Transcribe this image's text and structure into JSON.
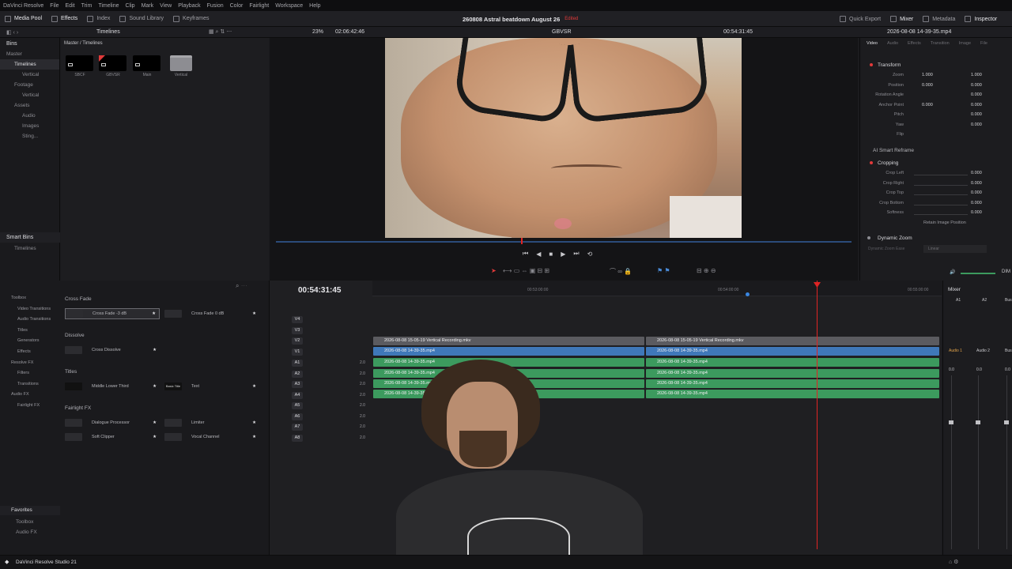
{
  "menubar": {
    "items": [
      "DaVinci Resolve",
      "File",
      "Edit",
      "Trim",
      "Timeline",
      "Clip",
      "Mark",
      "View",
      "Playback",
      "Fusion",
      "Color",
      "Fairlight",
      "Workspace",
      "Help"
    ]
  },
  "toolbar": {
    "media_pool": "Media Pool",
    "effects": "Effects",
    "index": "Index",
    "sound_library": "Sound Library",
    "keyframes": "Keyframes",
    "project_title": "260808 Astral beatdown August 26",
    "edited": "Edited",
    "quick_export": "Quick Export",
    "mixer": "Mixer",
    "metadata": "Metadata",
    "inspector": "Inspector"
  },
  "subbar": {
    "timelines": "Timelines",
    "zoom": "23%",
    "source_tc": "02:06:42:46",
    "viewer_title": "GBVSR",
    "record_tc": "00:54:31:45",
    "clip_name": "2026-08-08 14-39-35.mp4"
  },
  "bins": {
    "header": "Bins",
    "items": [
      {
        "label": "Master",
        "sel": false,
        "indent": 0
      },
      {
        "label": "Timelines",
        "sel": true,
        "indent": 1
      },
      {
        "label": "Vertical",
        "sel": false,
        "indent": 2
      },
      {
        "label": "Footage",
        "sel": false,
        "indent": 1
      },
      {
        "label": "Vertical",
        "sel": false,
        "indent": 2
      },
      {
        "label": "Assets",
        "sel": false,
        "indent": 1
      },
      {
        "label": "Audio",
        "sel": false,
        "indent": 2
      },
      {
        "label": "Images",
        "sel": false,
        "indent": 2
      },
      {
        "label": "Sting...",
        "sel": false,
        "indent": 2
      }
    ],
    "smart_bins": "Smart Bins",
    "smart_items": [
      "Timelines"
    ]
  },
  "media": {
    "path": "Master / Timelines",
    "thumbs": [
      "SBCF",
      "GBVSR",
      "Main",
      "Vertical"
    ]
  },
  "inspector": {
    "tabs": [
      "Video",
      "Audio",
      "Effects",
      "Transition",
      "Image",
      "File"
    ],
    "transform": "Transform",
    "rows": [
      {
        "label": "Zoom",
        "x": "1.000",
        "y": "1.000"
      },
      {
        "label": "Position",
        "x": "0.000",
        "y": "0.000"
      },
      {
        "label": "Rotation Angle",
        "x": "",
        "y": "0.000"
      },
      {
        "label": "Anchor Point",
        "x": "0.000",
        "y": "0.000"
      },
      {
        "label": "Pitch",
        "x": "",
        "y": "0.000"
      },
      {
        "label": "Yaw",
        "x": "",
        "y": "0.000"
      },
      {
        "label": "Flip",
        "x": "",
        "y": ""
      }
    ],
    "smart_reframe": "AI Smart Reframe",
    "cropping": "Cropping",
    "crop_rows": [
      {
        "label": "Crop Left",
        "val": "0.000"
      },
      {
        "label": "Crop Right",
        "val": "0.000"
      },
      {
        "label": "Crop Top",
        "val": "0.000"
      },
      {
        "label": "Crop Bottom",
        "val": "0.000"
      },
      {
        "label": "Softness",
        "val": "0.000"
      }
    ],
    "retain": "Retain Image Position",
    "dynamic_zoom": "Dynamic Zoom",
    "dz_ease": "Dynamic Zoom Ease",
    "dz_linear": "Linear"
  },
  "effects": {
    "tree": [
      {
        "label": "Toolbox",
        "indent": 0
      },
      {
        "label": "Video Transitions",
        "indent": 1
      },
      {
        "label": "Audio Transitions",
        "indent": 1
      },
      {
        "label": "Titles",
        "indent": 1
      },
      {
        "label": "Generators",
        "indent": 1
      },
      {
        "label": "Effects",
        "indent": 1
      },
      {
        "label": "Resolve FX",
        "indent": 0
      },
      {
        "label": "Filters",
        "indent": 1
      },
      {
        "label": "Transitions",
        "indent": 1
      },
      {
        "label": "Audio FX",
        "indent": 0
      },
      {
        "label": "Fairlight FX",
        "indent": 1
      }
    ],
    "cross_fade": "Cross Fade",
    "cf_minus3": "Cross Fade -3 dB",
    "cf_0": "Cross Fade 0 dB",
    "dissolve": "Dissolve",
    "cross_dissolve": "Cross Dissolve",
    "titles": "Titles",
    "middle_lower_third": "Middle Lower Third",
    "basic_title": "Basic Title",
    "text": "Text",
    "fairlight_fx": "Fairlight FX",
    "dialogue_processor": "Dialogue Processor",
    "limiter": "Limiter",
    "soft_clipper": "Soft Clipper",
    "vocal_channel": "Vocal Channel",
    "favorites": "Favorites",
    "fav_items": [
      "Toolbox",
      "Audio FX"
    ]
  },
  "timeline": {
    "timecode": "00:54:31:45",
    "ruler": [
      "00:53:00:00",
      "00:54:00:00",
      "00:55:00:00"
    ],
    "video_tracks": [
      "V4",
      "V3",
      "V2",
      "V1"
    ],
    "audio_tracks": [
      "A1",
      "A2",
      "A3",
      "A4",
      "A5",
      "A6",
      "A7",
      "A8"
    ],
    "audio_level": "2.0",
    "clip_v2": "2026-08-08 15-05-19 Vertical Recording.mkv",
    "clip_v1": "2026-08-08 14-39-35.mp4",
    "clip_a": "2026-08-08 14-39-35.mp4"
  },
  "mixer": {
    "title": "Mixer",
    "channels": [
      "A1",
      "A2",
      "Bus"
    ],
    "names": [
      "Audio 1",
      "Audio 2",
      "Bus"
    ],
    "levels": [
      "0.0",
      "0.0",
      "0.0"
    ],
    "dim": "DIM"
  },
  "status": {
    "app": "DaVinci Resolve Studio 21"
  },
  "colors": {
    "accent_red": "#e23a3a",
    "clip_blue": "#3f78b9",
    "clip_green": "#3c9a5e",
    "playhead": "#e02424"
  }
}
